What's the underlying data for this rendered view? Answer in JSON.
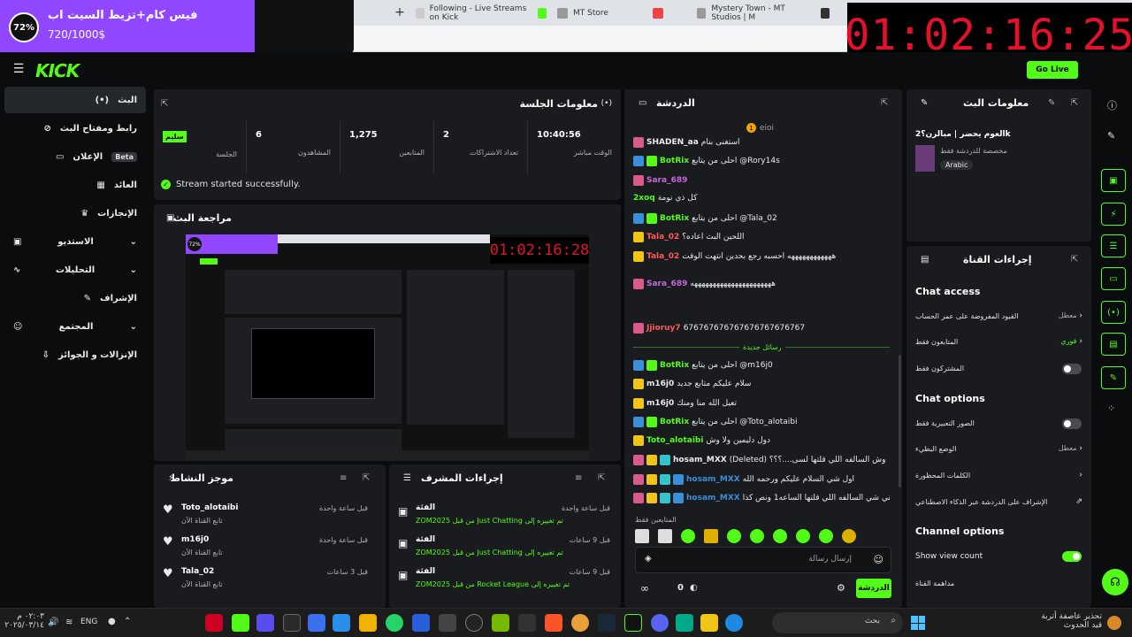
{
  "browser": {
    "tabs": [
      "Following - Live Streams on Kick",
      "MT Store",
      "Mystery Town - MT Studios | M"
    ]
  },
  "goal": {
    "percent": "72%",
    "percent_value": 0.72,
    "title": "فيس كام+تزيط السيت اب",
    "amount": "720/1000$"
  },
  "timer": "01:02:16:25",
  "header": {
    "go_live": "Go Live"
  },
  "nav": {
    "items": [
      {
        "label": "البث",
        "icon": "broadcast-icon"
      },
      {
        "label": "رابط ومفتاح البث",
        "icon": "link-icon"
      },
      {
        "label": "الإعلان",
        "badge": "Beta",
        "icon": "ad-icon"
      },
      {
        "label": "العائد",
        "icon": "revenue-icon"
      },
      {
        "label": "الإنجازات",
        "icon": "trophy-icon"
      },
      {
        "label": "الاستديو",
        "icon": "studio-icon"
      },
      {
        "label": "التحليلات",
        "icon": "analytics-icon"
      },
      {
        "label": "الإشراف",
        "icon": "moderation-icon"
      },
      {
        "label": "المجتمع",
        "icon": "community-icon"
      },
      {
        "label": "الإنزالات و الجوائز",
        "icon": "drops-icon"
      }
    ]
  },
  "session": {
    "title": "معلومات الجلسة",
    "stats": [
      {
        "value": "سليم",
        "label": "الجلسة"
      },
      {
        "value": "6",
        "label": "المشاهدون"
      },
      {
        "value": "1,275",
        "label": "المتابعين"
      },
      {
        "value": "2",
        "label": "تعداد الاشتراكات"
      },
      {
        "value": "10:40:56",
        "label": "الوقت مباشر"
      }
    ],
    "status": "Stream started successfully."
  },
  "preview": {
    "title": "مراجعة البث",
    "inner_timer": "01:02:16:28",
    "inner_pct": "72%"
  },
  "activity": {
    "title": "موجز النشاط",
    "items": [
      {
        "name": "Toto_alotaibi",
        "sub": "تابع القناة الآن",
        "time": "قبل ساعة واحدة"
      },
      {
        "name": "m16j0",
        "sub": "تابع القناة الآن",
        "time": "قبل ساعة واحدة"
      },
      {
        "name": "Tala_02",
        "sub": "تابع القناة الآن",
        "time": "قبل 3 ساعات"
      }
    ]
  },
  "modactions": {
    "title": "إجراءات المشرف",
    "items": [
      {
        "title": "الفئة",
        "line": "ZOM2025 من قبل Just Chatting تم تغييره إلى",
        "time": "قبل ساعة واحدة"
      },
      {
        "title": "الفئة",
        "line": "ZOM2025 من قبل Just Chatting تم تغييره إلى",
        "time": "قبل 9 ساعات"
      },
      {
        "title": "الفئة",
        "line": "ZOM2025 من قبل Rocket League تم تغييره إلى",
        "time": "قبل 9 ساعات"
      }
    ]
  },
  "chat": {
    "title": "الدردشة",
    "pinned_user": "eioi",
    "pinned_count": "1",
    "new_messages": "رسائل جديدة",
    "followers_only_label": "المتابعين فقط",
    "input_placeholder": "إرسال رسالة",
    "count": "0",
    "send_label": "الدردشة",
    "messages": [
      {
        "user": "SHADEN_aa",
        "color": "#e9eaec",
        "text": "استغنى بنام",
        "badges": [
          "#d95b8c"
        ]
      },
      {
        "user": "BotRix",
        "color": "#53fc18",
        "text": "احلى من يتابع @Rory14s",
        "badges": [
          "#3a8fd9",
          "#53fc18"
        ]
      },
      {
        "user": "Sara_689",
        "color": "#c46bd8",
        "text": "",
        "badges": [
          "#d95b8c"
        ]
      },
      {
        "user": "2xoq",
        "color": "#53fc18",
        "text": "كل ذي نومة",
        "badges": []
      },
      {
        "user": "BotRix",
        "color": "#53fc18",
        "text": "احلى من يتابع @Tala_02",
        "badges": [
          "#3a8fd9",
          "#53fc18"
        ]
      },
      {
        "user": "Tala_02",
        "color": "#ff5a5a",
        "text": "اللحين البث اعاده؟",
        "badges": [
          "#f0c419"
        ]
      },
      {
        "user": "Tala_02",
        "color": "#ff5a5a",
        "text": "ههههههههههههه احسبه رجع بحدين انتهت الوقت",
        "badges": [
          "#f0c419"
        ]
      },
      {
        "user": "Sara_689",
        "color": "#c46bd8",
        "text": "ههههههههههههههههههههههه",
        "badges": [
          "#d95b8c"
        ]
      },
      {
        "user": "Jjioruy7",
        "color": "#ff5a5a",
        "text": "676767676767676767676767",
        "badges": [
          "#d95b8c"
        ]
      },
      {
        "user": "BotRix",
        "color": "#53fc18",
        "text": "احلى من يتابع @m16j0",
        "badges": [
          "#3a8fd9",
          "#53fc18"
        ]
      },
      {
        "user": "m16j0",
        "color": "#e9eaec",
        "text": "سلام عليكم متابع جديد",
        "badges": [
          "#f0c419"
        ]
      },
      {
        "user": "m16j0",
        "color": "#e9eaec",
        "text": "تعيل الله منا ومنك",
        "badges": [
          "#f0c419"
        ]
      },
      {
        "user": "BotRix",
        "color": "#53fc18",
        "text": "احلى من يتابع @Toto_alotaibi",
        "badges": [
          "#3a8fd9",
          "#53fc18"
        ]
      },
      {
        "user": "Toto_alotaibi",
        "color": "#53fc18",
        "text": "دول دليمين ولا وش",
        "badges": [
          "#f0c419"
        ]
      },
      {
        "user": "hosam_MXX",
        "color": "#e9eaec",
        "text": "(Deleted) وش السالفه اللي قلتها لسى....؟؟؟",
        "badges": [
          "#d95b8c",
          "#f0c419",
          "#35c2c8"
        ]
      },
      {
        "user": "hosam_MXX",
        "color": "#3a8fd9",
        "text": "اول شي السلام عليكم ورحمه الله",
        "badges": [
          "#d95b8c",
          "#f0c419",
          "#35c2c8",
          "#3a8fd9"
        ]
      },
      {
        "user": "hosam_MXX",
        "color": "#3a8fd9",
        "text": "ثاني شي السالفه اللي قلتها الساعه1 ونص كذا",
        "badges": [
          "#d95b8c",
          "#f0c419",
          "#35c2c8",
          "#3a8fd9"
        ]
      }
    ]
  },
  "streaminfo": {
    "title": "معلومات البث",
    "stream_title": "العوم يحضر | مبالرن؟2k",
    "subtitle": "مخصصة للدردشة فقط",
    "language": "Arabic"
  },
  "channelactions": {
    "title": "إجراءات القناة",
    "chat_access": "Chat access",
    "rows1": [
      {
        "label": "القيود المفروضة على عمر الحساب",
        "value": "معطل"
      },
      {
        "label": "المتابعون فقط",
        "value": "فوري"
      },
      {
        "label": "المشتركون فقط",
        "value": ""
      }
    ],
    "chat_options": "Chat options",
    "rows2": [
      {
        "label": "الصور التعبيرية فقط",
        "value": ""
      },
      {
        "label": "الوضع البطيء",
        "value": "معطل"
      },
      {
        "label": "الكلمات المحظورة",
        "value": ""
      },
      {
        "label": "الإشراف على الدردشة عبر الذكاء الاصطناعي",
        "value": ""
      }
    ],
    "channel_options": "Channel options",
    "show_view_count": "Show view count",
    "host": "مداهمة القناة"
  },
  "taskbar": {
    "weather": "تحذير عاصفة أتربة",
    "weather_sub": "قيد الحدوث",
    "lang": "ENG",
    "time": "٠٢:٠٣ م",
    "date": "٢٠٢٥/٠٣/١٤",
    "search": "بحث"
  },
  "colors": {
    "accent": "#53fc18",
    "panel": "#191b1f",
    "bg": "#0b0c0e",
    "goal": "#9147ff",
    "timer": "#e5112b"
  }
}
